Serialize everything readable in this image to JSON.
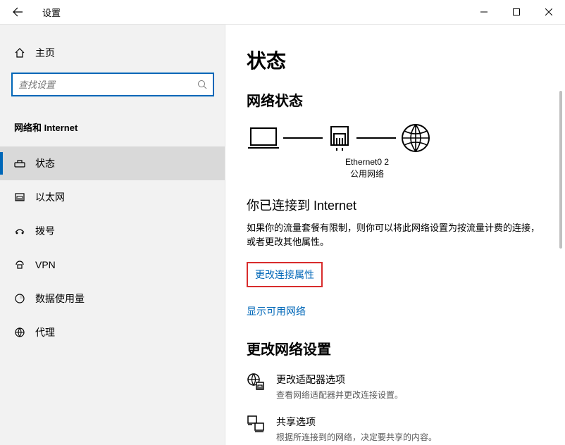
{
  "titlebar": {
    "title": "设置"
  },
  "sidebar": {
    "home": "主页",
    "search_placeholder": "查找设置",
    "group": "网络和 Internet",
    "items": [
      {
        "label": "状态"
      },
      {
        "label": "以太网"
      },
      {
        "label": "拨号"
      },
      {
        "label": "VPN"
      },
      {
        "label": "数据使用量"
      },
      {
        "label": "代理"
      }
    ]
  },
  "content": {
    "heading": "状态",
    "subheading": "网络状态",
    "diagram": {
      "adapter": "Ethernet0 2",
      "network_type": "公用网络"
    },
    "connected_heading": "你已连接到 Internet",
    "connected_para": "如果你的流量套餐有限制，则你可以将此网络设置为按流量计费的连接，或者更改其他属性。",
    "link_change_props": "更改连接属性",
    "link_show_networks": "显示可用网络",
    "change_settings_heading": "更改网络设置",
    "options": [
      {
        "title": "更改适配器选项",
        "desc": "查看网络适配器并更改连接设置。"
      },
      {
        "title": "共享选项",
        "desc": "根据所连接到的网络，决定要共享的内容。"
      }
    ]
  }
}
